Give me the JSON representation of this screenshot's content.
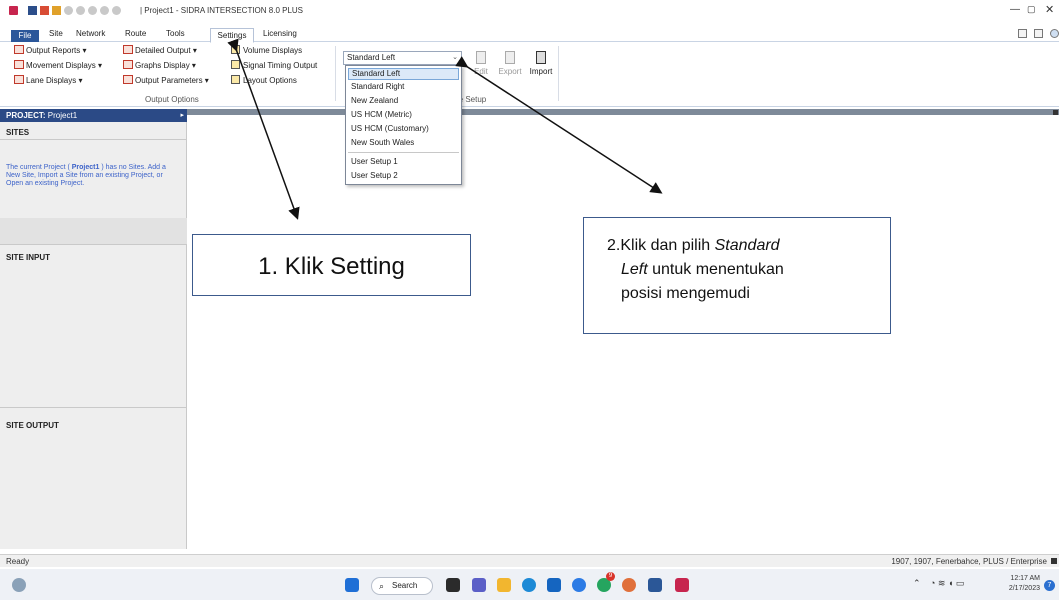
{
  "window": {
    "title": "| Project1 - SIDRA INTERSECTION 8.0 PLUS",
    "minimize_glyph": "—",
    "maximize_glyph": "▢",
    "close_glyph": "✕"
  },
  "menu": {
    "file": "File",
    "site": "Site",
    "network": "Network",
    "route": "Route",
    "tools": "Tools",
    "settings": "Settings",
    "licensing": "Licensing"
  },
  "ribbon": {
    "output_reports": "Output Reports ▾",
    "movement_displays": "Movement Displays ▾",
    "lane_displays": "Lane Displays ▾",
    "detailed_output": "Detailed Output ▾",
    "graphs_display": "Graphs Display ▾",
    "output_parameters": "Output Parameters ▾",
    "volume_displays": "Volume Displays",
    "signal_timing_output": "Signal Timing Output",
    "layout_options": "Layout Options",
    "output_options_label": "Output Options",
    "setup_label": "re Setup",
    "standard_combo_value": "Standard Left",
    "edit_label": "Edit",
    "export_label": "Export",
    "import_label": "Import"
  },
  "dropdown": {
    "items": [
      "Standard Left",
      "Standard Right",
      "New Zealand",
      "US HCM (Metric)",
      "US HCM (Customary)",
      "New South Wales",
      "User Setup 1",
      "User Setup 2"
    ]
  },
  "left_panel": {
    "project_label": "PROJECT:",
    "project_name": "Project1",
    "sites_heading": "SITES",
    "sites_message_1": "The current Project ( ",
    "sites_message_bold": "Project1",
    "sites_message_2": " ) has no Sites. Add a New Site, Import a Site from an existing Project, or Open an existing Project.",
    "site_input_heading": "SITE INPUT",
    "site_output_heading": "SITE OUTPUT"
  },
  "status": {
    "ready": "Ready",
    "right_text": "1907, 1907, Fenerbahce, PLUS / Enterprise"
  },
  "taskbar": {
    "search": "Search",
    "clock_time": "12:17 AM",
    "clock_date": "2/17/2023",
    "notification_count": "7",
    "chat_badge": "9"
  },
  "annotations": {
    "callout_1": "1. Klik Setting",
    "callout_2_line1_prefix": "2.Klik dan pilih ",
    "callout_2_line1_italic": "Standard",
    "callout_2_line2_italic": "Left",
    "callout_2_line2_rest": " untuk menentukan",
    "callout_2_line3": "posisi mengemudi"
  },
  "colors": {
    "file_tab": "#2b579a",
    "project_header": "#2b4a86",
    "dropdown_highlight": "#dce9f8",
    "callout_border": "#3c5a8c"
  }
}
